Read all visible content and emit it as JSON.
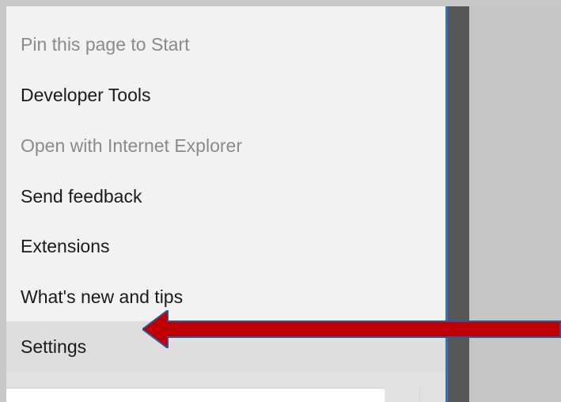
{
  "menu": {
    "items": [
      {
        "label": "Pin this page to Start",
        "state": "disabled"
      },
      {
        "label": "Developer Tools",
        "state": "enabled"
      },
      {
        "label": "Open with Internet Explorer",
        "state": "disabled"
      },
      {
        "label": "Send feedback",
        "state": "enabled"
      },
      {
        "label": "Extensions",
        "state": "enabled"
      },
      {
        "label": "What's new and tips",
        "state": "enabled"
      },
      {
        "label": "Settings",
        "state": "selected"
      }
    ]
  },
  "annotation": {
    "arrow_icon": "left-arrow-icon",
    "color": "#c00000",
    "stroke_color": "#2f5597"
  },
  "colors": {
    "background": "#c8c8c8",
    "menu_bg": "#f2f2f2",
    "selected_bg": "#dedede",
    "accent_edge": "#2f74c0",
    "dark_column": "#575757"
  }
}
